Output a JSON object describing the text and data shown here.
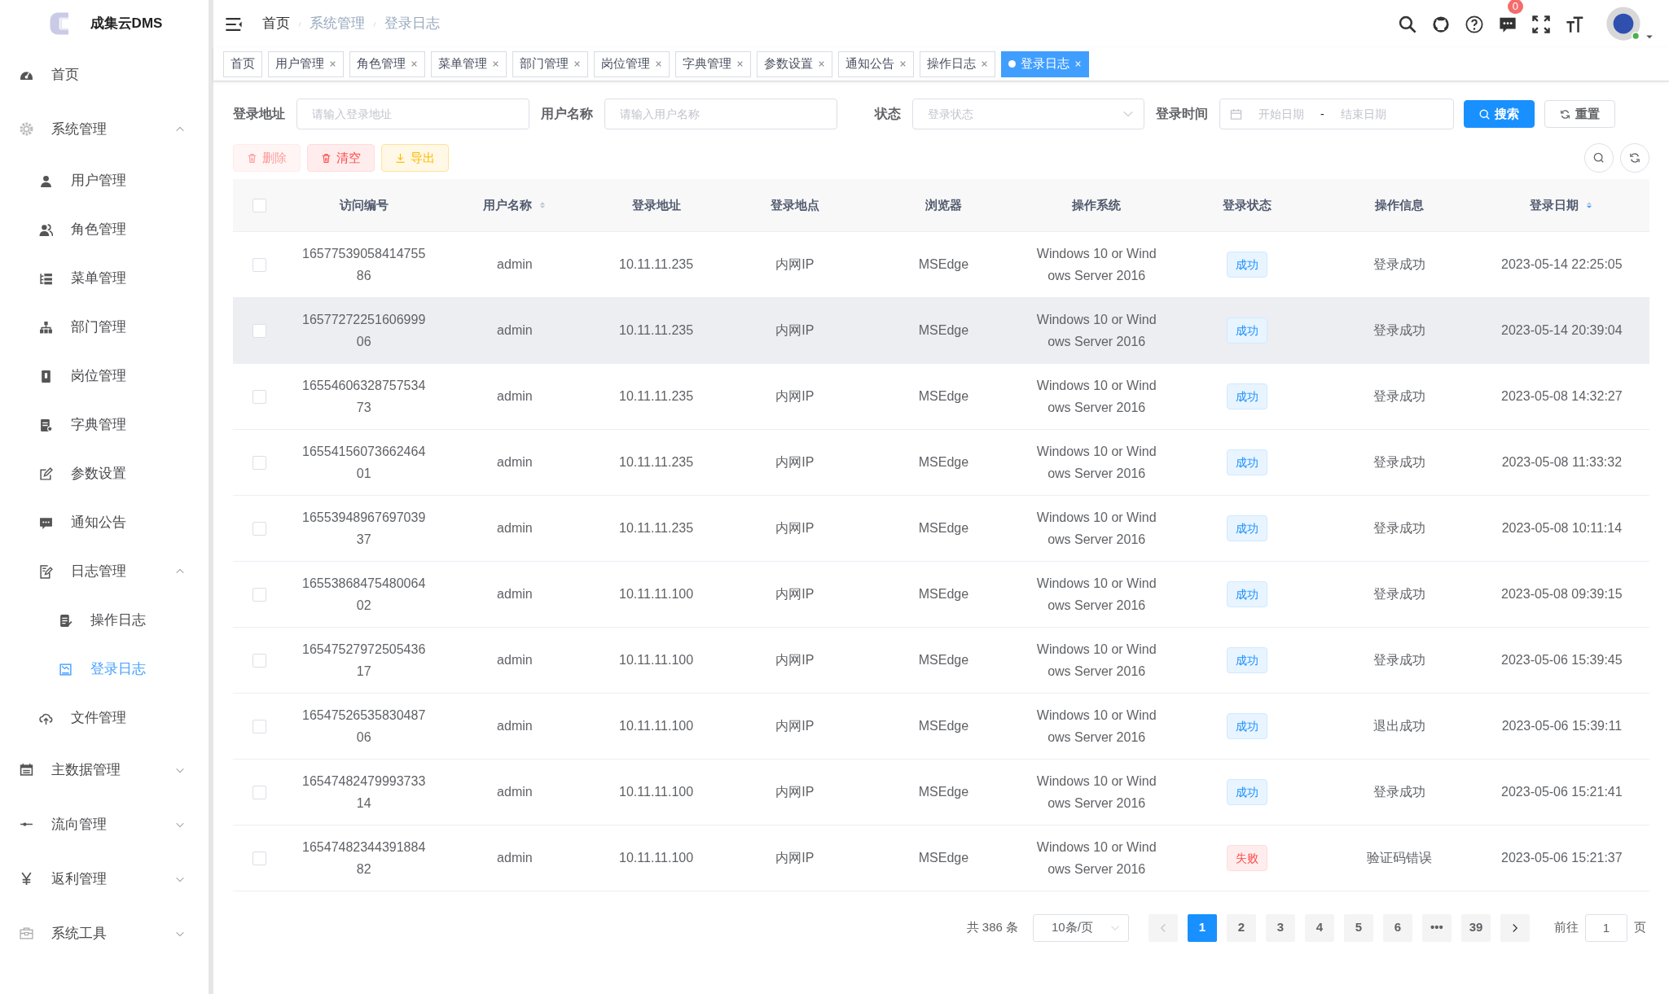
{
  "sidebar": {
    "logo_text": "成集云DMS",
    "items": [
      {
        "label": "首页",
        "selected": false
      },
      {
        "label": "系统管理",
        "selected": false,
        "expanded": true,
        "children": [
          {
            "label": "用户管理",
            "selected": false
          },
          {
            "label": "角色管理",
            "selected": false
          },
          {
            "label": "菜单管理",
            "selected": false
          },
          {
            "label": "部门管理",
            "selected": false
          },
          {
            "label": "岗位管理",
            "selected": false
          },
          {
            "label": "字典管理",
            "selected": false
          },
          {
            "label": "参数设置",
            "selected": false
          },
          {
            "label": "通知公告",
            "selected": false
          },
          {
            "label": "日志管理",
            "selected": false,
            "expanded": true,
            "children": [
              {
                "label": "操作日志",
                "selected": false
              },
              {
                "label": "登录日志",
                "selected": true
              }
            ]
          },
          {
            "label": "文件管理",
            "selected": false
          }
        ]
      },
      {
        "label": "主数据管理",
        "selected": false,
        "expanded": false
      },
      {
        "label": "流向管理",
        "selected": false,
        "expanded": false
      },
      {
        "label": "返利管理",
        "selected": false,
        "expanded": false
      },
      {
        "label": "系统工具",
        "selected": false,
        "expanded": false
      }
    ]
  },
  "header": {
    "breadcrumb": [
      "首页",
      "系统管理",
      "登录日志"
    ],
    "notification_count": "0"
  },
  "tabs": [
    {
      "label": "首页",
      "closable": false,
      "selected": false
    },
    {
      "label": "用户管理",
      "closable": true,
      "selected": false
    },
    {
      "label": "角色管理",
      "closable": true,
      "selected": false
    },
    {
      "label": "菜单管理",
      "closable": true,
      "selected": false
    },
    {
      "label": "部门管理",
      "closable": true,
      "selected": false
    },
    {
      "label": "岗位管理",
      "closable": true,
      "selected": false
    },
    {
      "label": "字典管理",
      "closable": true,
      "selected": false
    },
    {
      "label": "参数设置",
      "closable": true,
      "selected": false
    },
    {
      "label": "通知公告",
      "closable": true,
      "selected": false
    },
    {
      "label": "操作日志",
      "closable": true,
      "selected": false
    },
    {
      "label": "登录日志",
      "closable": true,
      "selected": true
    }
  ],
  "filters": [
    {
      "label": "登录地址",
      "kind": "text",
      "placeholder": "请输入登录地址"
    },
    {
      "label": "用户名称",
      "kind": "text",
      "placeholder": "请输入用户名称"
    },
    {
      "label": "状态",
      "kind": "select",
      "placeholder": "登录状态"
    },
    {
      "label": "登录时间",
      "kind": "daterange",
      "start_placeholder": "开始日期",
      "separator": "-",
      "end_placeholder": "结束日期"
    }
  ],
  "search_buttons": [
    {
      "label": "搜索",
      "kind": "primary"
    },
    {
      "label": "重置",
      "kind": "default"
    }
  ],
  "actions": [
    {
      "label": "删除",
      "kind": "danger",
      "disabled": true
    },
    {
      "label": "清空",
      "kind": "danger",
      "disabled": false
    },
    {
      "label": "导出",
      "kind": "warning",
      "disabled": false
    }
  ],
  "table": {
    "all_selected": false,
    "columns": [
      {
        "label": "访问编号"
      },
      {
        "label": "用户名称",
        "sort_descending": false
      },
      {
        "label": "登录地址"
      },
      {
        "label": "登录地点"
      },
      {
        "label": "浏览器"
      },
      {
        "label": "操作系统"
      },
      {
        "label": "登录状态"
      },
      {
        "label": "操作信息"
      },
      {
        "label": "登录日期",
        "sort_descending": true
      }
    ],
    "rows": [
      {
        "selected": false,
        "highlighted": false,
        "id": "1657753905841475586",
        "user": "admin",
        "ip": "10.11.11.235",
        "location": "内网IP",
        "browser": "MSEdge",
        "os": "Windows 10 or Windows Server 2016",
        "status": "成功",
        "failed": false,
        "message": "登录成功",
        "date": "2023-05-14 22:25:05"
      },
      {
        "selected": false,
        "highlighted": true,
        "id": "1657727225160699906",
        "user": "admin",
        "ip": "10.11.11.235",
        "location": "内网IP",
        "browser": "MSEdge",
        "os": "Windows 10 or Windows Server 2016",
        "status": "成功",
        "failed": false,
        "message": "登录成功",
        "date": "2023-05-14 20:39:04"
      },
      {
        "selected": false,
        "highlighted": false,
        "id": "1655460632875753473",
        "user": "admin",
        "ip": "10.11.11.235",
        "location": "内网IP",
        "browser": "MSEdge",
        "os": "Windows 10 or Windows Server 2016",
        "status": "成功",
        "failed": false,
        "message": "登录成功",
        "date": "2023-05-08 14:32:27"
      },
      {
        "selected": false,
        "highlighted": false,
        "id": "1655415607366246401",
        "user": "admin",
        "ip": "10.11.11.235",
        "location": "内网IP",
        "browser": "MSEdge",
        "os": "Windows 10 or Windows Server 2016",
        "status": "成功",
        "failed": false,
        "message": "登录成功",
        "date": "2023-05-08 11:33:32"
      },
      {
        "selected": false,
        "highlighted": false,
        "id": "1655394896769703937",
        "user": "admin",
        "ip": "10.11.11.235",
        "location": "内网IP",
        "browser": "MSEdge",
        "os": "Windows 10 or Windows Server 2016",
        "status": "成功",
        "failed": false,
        "message": "登录成功",
        "date": "2023-05-08 10:11:14"
      },
      {
        "selected": false,
        "highlighted": false,
        "id": "1655386847548006402",
        "user": "admin",
        "ip": "10.11.11.100",
        "location": "内网IP",
        "browser": "MSEdge",
        "os": "Windows 10 or Windows Server 2016",
        "status": "成功",
        "failed": false,
        "message": "登录成功",
        "date": "2023-05-08 09:39:15"
      },
      {
        "selected": false,
        "highlighted": false,
        "id": "1654752797250543617",
        "user": "admin",
        "ip": "10.11.11.100",
        "location": "内网IP",
        "browser": "MSEdge",
        "os": "Windows 10 or Windows Server 2016",
        "status": "成功",
        "failed": false,
        "message": "登录成功",
        "date": "2023-05-06 15:39:45"
      },
      {
        "selected": false,
        "highlighted": false,
        "id": "1654752653583048706",
        "user": "admin",
        "ip": "10.11.11.100",
        "location": "内网IP",
        "browser": "MSEdge",
        "os": "Windows 10 or Windows Server 2016",
        "status": "成功",
        "failed": false,
        "message": "退出成功",
        "date": "2023-05-06 15:39:11"
      },
      {
        "selected": false,
        "highlighted": false,
        "id": "1654748247999373314",
        "user": "admin",
        "ip": "10.11.11.100",
        "location": "内网IP",
        "browser": "MSEdge",
        "os": "Windows 10 or Windows Server 2016",
        "status": "成功",
        "failed": false,
        "message": "登录成功",
        "date": "2023-05-06 15:21:41"
      },
      {
        "selected": false,
        "highlighted": false,
        "id": "1654748234439188482",
        "user": "admin",
        "ip": "10.11.11.100",
        "location": "内网IP",
        "browser": "MSEdge",
        "os": "Windows 10 or Windows Server 2016",
        "status": "失败",
        "failed": true,
        "message": "验证码错误",
        "date": "2023-05-06 15:21:37"
      }
    ]
  },
  "pagination": {
    "total": "共 386 条",
    "page_size": "10条/页",
    "prev_disabled": true,
    "next_disabled": false,
    "pages": [
      {
        "label": "1",
        "selected": true
      },
      {
        "label": "2",
        "selected": false
      },
      {
        "label": "3",
        "selected": false
      },
      {
        "label": "4",
        "selected": false
      },
      {
        "label": "5",
        "selected": false
      },
      {
        "label": "6",
        "selected": false
      },
      {
        "label": "•••",
        "selected": false
      },
      {
        "label": "39",
        "selected": false
      }
    ],
    "goto_label": "前往",
    "goto_value": "1",
    "goto_suffix": "页"
  }
}
